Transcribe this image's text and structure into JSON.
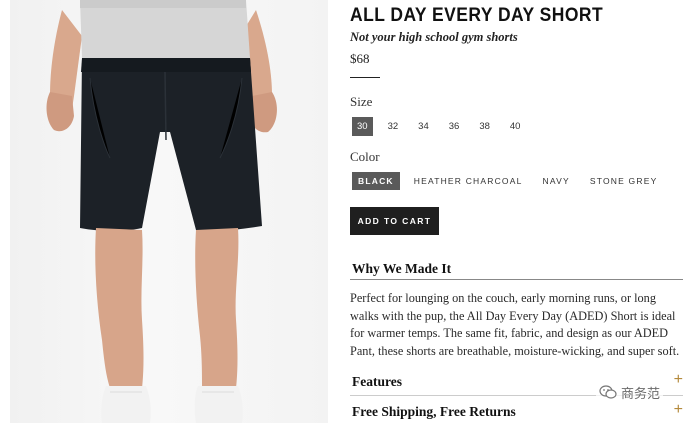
{
  "product": {
    "title": "ALL DAY EVERY DAY SHORT",
    "subtitle": "Not your high school gym shorts",
    "price": "$68"
  },
  "size": {
    "label": "Size",
    "options": [
      "30",
      "32",
      "34",
      "36",
      "38",
      "40"
    ],
    "selected": "30"
  },
  "color": {
    "label": "Color",
    "options": [
      "BLACK",
      "HEATHER CHARCOAL",
      "NAVY",
      "STONE GREY"
    ],
    "selected": "BLACK"
  },
  "add_to_cart_label": "ADD TO CART",
  "why": {
    "title": "Why We Made It",
    "body": "Perfect for lounging on the couch, early morning runs, or long walks with the pup, the All Day Every Day (ADED) Short is ideal for warmer temps. The same fit, fabric, and design as our ADED Pant, these shorts are breathable, moisture-wicking, and super soft."
  },
  "accordions": [
    {
      "title": "Features",
      "icon": "plus-icon"
    },
    {
      "title": "Free Shipping, Free Returns",
      "icon": "plus-icon"
    }
  ],
  "watermark": {
    "text": "商务范",
    "icon": "wechat-icon"
  },
  "colors": {
    "selected_bg": "#5a5a5a",
    "button_bg": "#1f1f1f",
    "accent_plus": "#b48a3c"
  }
}
